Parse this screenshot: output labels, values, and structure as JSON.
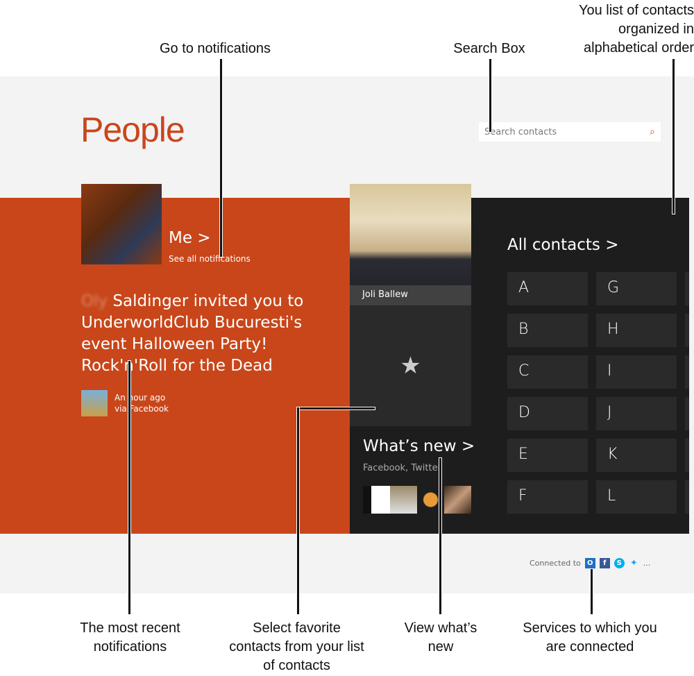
{
  "app": {
    "title": "People",
    "search_placeholder": "Search contacts",
    "search_icon": "search-icon"
  },
  "me": {
    "label": "Me >",
    "see_all": "See all notifications"
  },
  "notification": {
    "blurred_name": "Oly",
    "text": " Saldinger invited you to UnderworldClub Bucuresti's event Halloween Party! Rock'n'Roll for the Dead",
    "time": "An hour ago",
    "source": "via Facebook"
  },
  "favorite": {
    "name": "Joli Ballew",
    "star_icon": "star-icon"
  },
  "whats_new": {
    "title": "What’s new >",
    "subtitle": "Facebook, Twitter"
  },
  "contacts": {
    "title": "All contacts >",
    "letters": [
      "A",
      "B",
      "C",
      "D",
      "E",
      "F",
      "G",
      "H",
      "I",
      "J",
      "K",
      "L"
    ]
  },
  "connected": {
    "label": "Connected to",
    "services": [
      "outlook",
      "facebook",
      "skype",
      "twitter"
    ],
    "more": "..."
  },
  "annotations": {
    "notifications": "Go to notifications",
    "search": "Search Box",
    "contacts": "You list of contacts organized in alphabetical order",
    "recent": "The most recent notifications",
    "favorites": "Select favorite contacts from your list of contacts",
    "whatsnew": "View what’s new",
    "services": "Services to which you are connected"
  },
  "colors": {
    "accent": "#c8461a",
    "dark": "#1d1d1d",
    "tile": "#2a2a2a",
    "background": "#f3f3f3"
  }
}
